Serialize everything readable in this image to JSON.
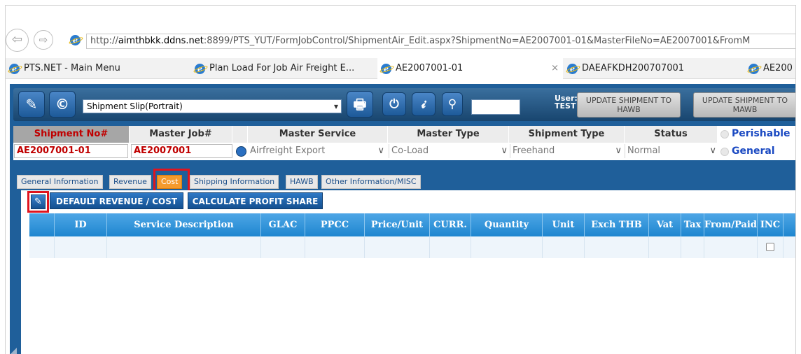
{
  "browser": {
    "back_icon": "⇦",
    "forward_icon": "⇨",
    "url_prefix": "http://",
    "url_host": "aimthbkk.ddns.net",
    "url_rest": ":8899/PTS_YUT/FormJobControl/ShipmentAir_Edit.aspx?ShipmentNo=AE2007001-01&MasterFileNo=AE2007001&FromM",
    "tabs": [
      {
        "label": "PTS.NET - Main Menu"
      },
      {
        "label": "Plan Load For Job Air Freight E..."
      },
      {
        "label": "AE2007001-01",
        "close": "×"
      },
      {
        "label": "DAEAFKDH200707001"
      },
      {
        "label": "AE200"
      }
    ]
  },
  "toolbar": {
    "edit_icon": "✎",
    "copyright_icon": "©",
    "print_select": "Shipment Slip(Portrait)",
    "print_icon": "🖶",
    "power_icon": "⏻",
    "info_icon": "𝓲",
    "key_icon": "⚲",
    "user_label": "User:",
    "user_name": "TEST",
    "update_hawb": "UPDATE SHIPMENT TO HAWB",
    "update_mawb": "UPDATE SHIPMENT TO MAWB"
  },
  "header": {
    "shipment_no_label": "Shipment No#",
    "master_job_label": "Master Job#",
    "master_service_label": "Master Service",
    "master_type_label": "Master Type",
    "shipment_type_label": "Shipment Type",
    "status_label": "Status",
    "perishable_label": "Perishable",
    "shipment_no": "AE2007001-01",
    "master_job": "AE2007001",
    "master_service": "Airfreight Export",
    "master_type": "Co-Load",
    "shipment_type": "Freehand",
    "status": "Normal",
    "general_label": "General"
  },
  "tabs": [
    {
      "label": "General Information"
    },
    {
      "label": "Revenue"
    },
    {
      "label": "Cost",
      "active": true
    },
    {
      "label": "Shipping Information"
    },
    {
      "label": "HAWB"
    },
    {
      "label": "Other Information/MISC"
    }
  ],
  "actions": {
    "edit_icon": "✎",
    "default_revenue_cost": "DEFAULT REVENUE / COST",
    "calculate_profit_share": "CALCULATE PROFIT SHARE"
  },
  "grid": {
    "columns": [
      "ID",
      "Service Description",
      "GLAC",
      "PPCC",
      "Price/Unit",
      "CURR.",
      "Quantity",
      "Unit",
      "Exch THB",
      "Vat",
      "Tax",
      "From/Paid",
      "INC"
    ],
    "rows": []
  },
  "colors": {
    "accent_orange": "#f59a2c",
    "highlight_red": "#e0141e",
    "header_blue": "#1f5f9a"
  }
}
